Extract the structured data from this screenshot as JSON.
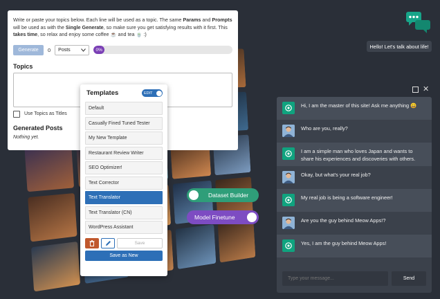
{
  "generator": {
    "intro_1": "Write or paste your topics below. Each line will be used as a topic. The same ",
    "intro_params": "Params",
    "intro_and": " and ",
    "intro_prompts": "Prompts",
    "intro_2": " will be used as with the ",
    "intro_single": "Single Generate",
    "intro_3": ", so make sure you get satisfying results with it first. This ",
    "intro_takes": "takes time",
    "intro_4": ", so relax and enjoy some coffee ☕ and tea 🍵 :)",
    "generate_label": "Generate",
    "count_value": "0",
    "post_type": "Posts",
    "progress_value": 0,
    "progress_label": "0%",
    "topics_title": "Topics",
    "topics_value": "",
    "use_topics_label": "Use Topics as Titles",
    "generated_title": "Generated Posts",
    "nothing_yet": "Nothing yet."
  },
  "templates": {
    "title": "Templates",
    "edit_label": "EDIT",
    "items": [
      {
        "label": "Default",
        "active": false
      },
      {
        "label": "Casually Fined Tuned Tester",
        "active": false
      },
      {
        "label": "My New Template",
        "active": false
      },
      {
        "label": "Restaurant Review Writer",
        "active": false
      },
      {
        "label": "SEO Optimizer!",
        "active": false
      },
      {
        "label": "Text Corrector",
        "active": false
      },
      {
        "label": "Text Translator",
        "active": true
      },
      {
        "label": "Text Translator (CN)",
        "active": false
      },
      {
        "label": "WordPress Assistant",
        "active": false
      }
    ],
    "save_label": "Save",
    "save_as_new_label": "Save as New"
  },
  "toggles": {
    "dataset_builder": "Dataset Builder",
    "model_finetune": "Model Finetune"
  },
  "chat": {
    "greeting": "Hello! Let's talk about life!",
    "messages": [
      {
        "role": "ai",
        "text": "Hi, I am the master of this site! Ask me anything 😀"
      },
      {
        "role": "user",
        "text": "Who are you, really?"
      },
      {
        "role": "ai",
        "text": "I am a simple man who loves Japan and wants to share his experiences and discoveries with others."
      },
      {
        "role": "user",
        "text": "Okay, but what's your real job?"
      },
      {
        "role": "ai",
        "text": "My real job is being a software engineer!"
      },
      {
        "role": "user",
        "text": "Are you the guy behind Meow Apps!?"
      },
      {
        "role": "ai",
        "text": "Yes, I am the guy behind Meow Apps!"
      }
    ],
    "input_placeholder": "Type your message...",
    "send_label": "Send"
  },
  "colors": {
    "accent_blue": "#2d6fb7",
    "progress_purple": "#7a3fb5",
    "dataset_green": "#2f9e79",
    "finetune_purple": "#7d4cc2",
    "ai_green": "#10a37f",
    "chat_icon_green": "#17a589"
  }
}
